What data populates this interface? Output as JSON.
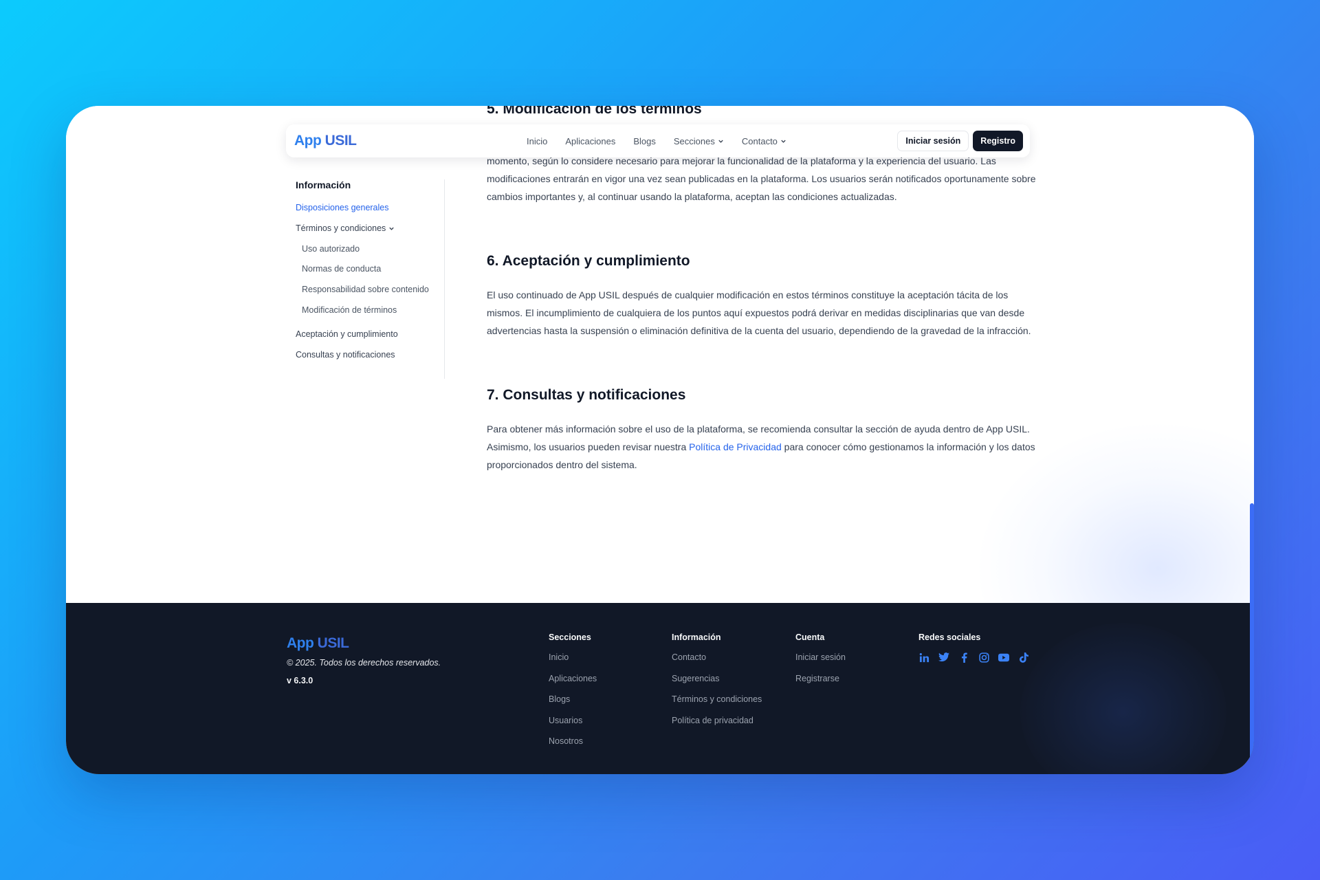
{
  "brand": {
    "part1": "App",
    "part2": "USIL"
  },
  "navbar": {
    "links": [
      "Inicio",
      "Aplicaciones",
      "Blogs"
    ],
    "dropdowns": [
      "Secciones",
      "Contacto"
    ],
    "login_label": "Iniciar sesión",
    "register_label": "Registro"
  },
  "sidebar": {
    "title": "Información",
    "items": [
      "Disposiciones generales",
      "Términos y condiciones",
      "Uso autorizado",
      "Normas de conducta",
      "Responsabilidad sobre contenido",
      "Modificación de términos",
      "Aceptación y cumplimiento",
      "Consultas y notificaciones"
    ]
  },
  "article": {
    "s5_title": "5. Modificación de los términos",
    "s5_text_hidden": "",
    "s5_text": "momento, según lo considere necesario para mejorar la funcionalidad de la plataforma y la experiencia del usuario. Las modificaciones entrarán en vigor una vez sean publicadas en la plataforma. Los usuarios serán notificados oportunamente sobre cambios importantes y, al continuar usando la plataforma, aceptan las condiciones actualizadas.",
    "s6_title": "6. Aceptación y cumplimiento",
    "s6_text": "El uso continuado de App USIL después de cualquier modificación en estos términos constituye la aceptación tácita de los mismos. El incumplimiento de cualquiera de los puntos aquí expuestos podrá derivar en medidas disciplinarias que van desde advertencias hasta la suspensión o eliminación definitiva de la cuenta del usuario, dependiendo de la gravedad de la infracción.",
    "s7_title": "7. Consultas y notificaciones",
    "s7_text_before": "Para obtener más información sobre el uso de la plataforma, se recomienda consultar la sección de ayuda dentro de App USIL. Asimismo, los usuarios pueden revisar nuestra ",
    "s7_link": "Política de Privacidad",
    "s7_text_after": " para conocer cómo gestionamos la información y los datos proporcionados dentro del sistema."
  },
  "footer": {
    "copyright": "© 2025. Todos los derechos reservados.",
    "version": "v 6.3.0",
    "columns": [
      {
        "title": "Secciones",
        "links": [
          "Inicio",
          "Aplicaciones",
          "Blogs",
          "Usuarios",
          "Nosotros"
        ]
      },
      {
        "title": "Información",
        "links": [
          "Contacto",
          "Sugerencias",
          "Términos y condiciones",
          "Política de privacidad"
        ]
      },
      {
        "title": "Cuenta",
        "links": [
          "Iniciar sesión",
          "Registrarse"
        ]
      }
    ],
    "social_title": "Redes sociales",
    "social_icons": [
      "linkedin-icon",
      "twitter-icon",
      "facebook-icon",
      "instagram-icon",
      "youtube-icon",
      "tiktok-icon"
    ]
  },
  "colors": {
    "accent": "#2563eb",
    "dark": "#111827",
    "social": "#3b82f6"
  }
}
